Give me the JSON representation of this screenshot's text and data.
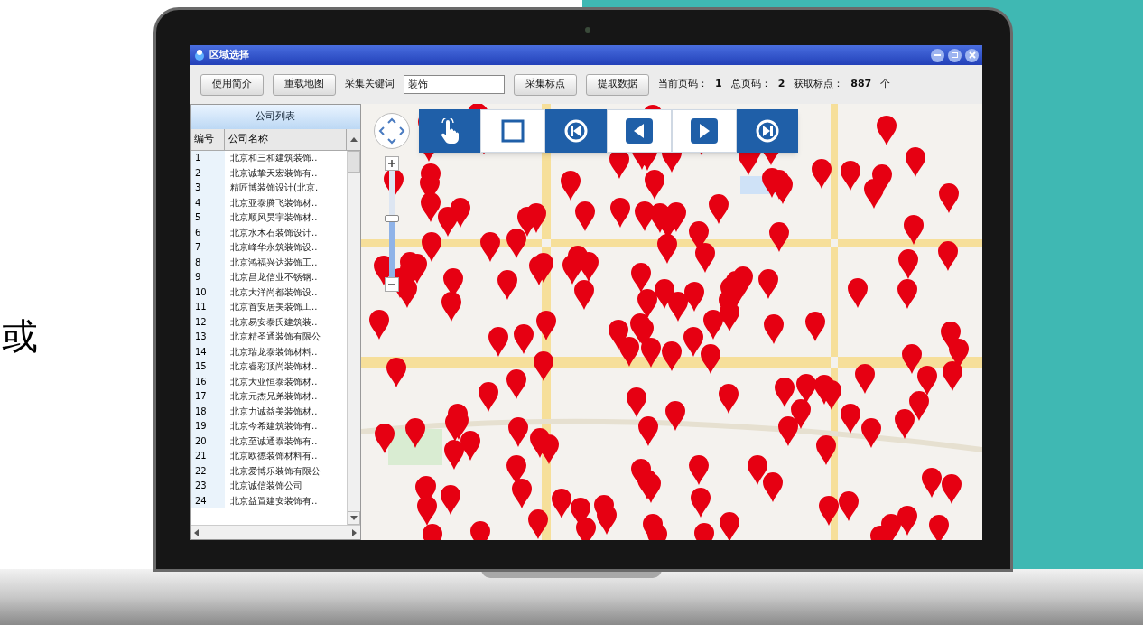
{
  "side_text": "或",
  "window": {
    "title": "区域选择"
  },
  "toolbar": {
    "buttons": [
      "使用简介",
      "重载地图"
    ],
    "keyword_label": "采集关键词",
    "keyword_value": "装饰",
    "actions": [
      "采集标点",
      "提取数据"
    ],
    "stats": [
      {
        "label": "当前页码：",
        "value": "1"
      },
      {
        "label": "总页码：",
        "value": "2"
      },
      {
        "label": "获取标点：",
        "value": "887"
      }
    ],
    "unit": "个"
  },
  "company_list": {
    "title": "公司列表",
    "columns": [
      "编号",
      "公司名称"
    ],
    "rows": [
      [
        "1",
        "北京和三和建筑装饰.."
      ],
      [
        "2",
        "北京诚挚天宏装饰有.."
      ],
      [
        "3",
        "精匠博装饰设计(北京."
      ],
      [
        "4",
        "北京亚泰腾飞装饰材.."
      ],
      [
        "5",
        "北京顺风昊宇装饰材.."
      ],
      [
        "6",
        "北京水木石装饰设计.."
      ],
      [
        "7",
        "北京峰华永筑装饰设.."
      ],
      [
        "8",
        "北京鸿福兴达装饰工.."
      ],
      [
        "9",
        "北京昌龙信业不锈钢.."
      ],
      [
        "10",
        "北京大洋尚都装饰设.."
      ],
      [
        "11",
        "北京首安居美装饰工.."
      ],
      [
        "12",
        "北京易安泰氏建筑装.."
      ],
      [
        "13",
        "北京精圣通装饰有限公"
      ],
      [
        "14",
        "北京瑞龙泰装饰材料.."
      ],
      [
        "15",
        "北京睿彩顶尚装饰材.."
      ],
      [
        "16",
        "北京大亚恒泰装饰材.."
      ],
      [
        "17",
        "北京元杰兄弟装饰材.."
      ],
      [
        "18",
        "北京力诚益美装饰材.."
      ],
      [
        "19",
        "北京今希建筑装饰有.."
      ],
      [
        "20",
        "北京至诚通泰装饰有.."
      ],
      [
        "21",
        "北京欧德装饰材料有.."
      ],
      [
        "22",
        "北京爱博乐装饰有限公"
      ],
      [
        "23",
        "北京诚信装饰公司"
      ],
      [
        "24",
        "北京益置建安装饰有.."
      ]
    ]
  },
  "map_zoom": {
    "level": 0.55
  },
  "map_tools": [
    {
      "kind": "hand",
      "selected": true
    },
    {
      "kind": "select",
      "selected": false
    },
    {
      "kind": "first",
      "selected": true
    },
    {
      "kind": "prev",
      "selected": false
    },
    {
      "kind": "next",
      "selected": false
    },
    {
      "kind": "last",
      "selected": true
    }
  ]
}
